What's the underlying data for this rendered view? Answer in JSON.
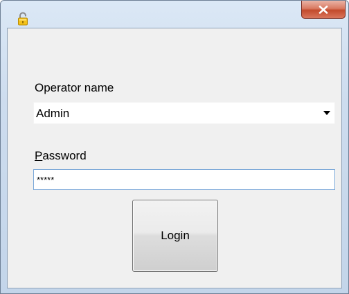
{
  "window": {
    "icon": "lock-open-icon",
    "close_icon": "close-icon"
  },
  "form": {
    "operator_label": "Operator name",
    "operator_value": "Admin",
    "password_label_mnemonic": "P",
    "password_label_rest": "assword",
    "password_value": "*****",
    "login_label": "Login"
  },
  "colors": {
    "close_button": "#c34a2c",
    "focus_border": "#7aa7d8",
    "client_background": "#f0f0f0"
  }
}
